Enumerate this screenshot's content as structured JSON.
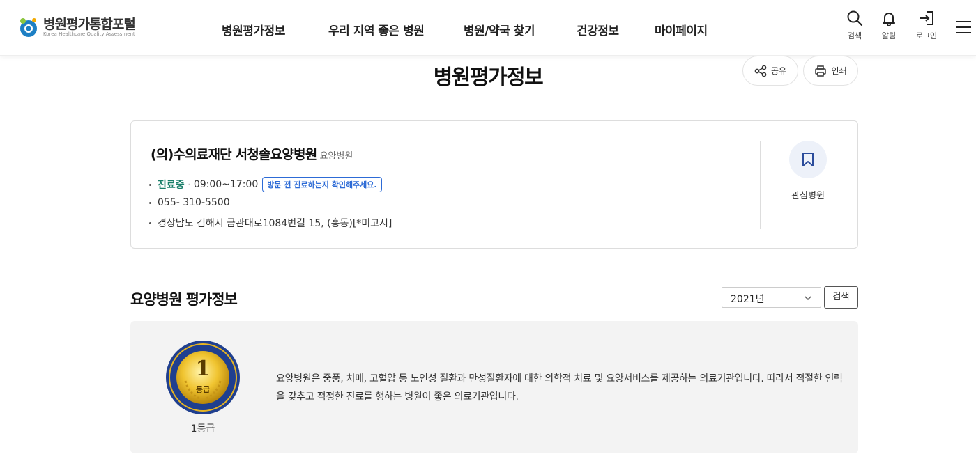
{
  "header": {
    "logo_title": "병원평가통합포털",
    "logo_subtitle": "Korea Healthcare Quality Assessment",
    "nav": [
      "병원평가정보",
      "우리 지역 좋은 병원",
      "병원/약국 찾기",
      "건강정보",
      "마이페이지"
    ],
    "utils": {
      "search_label": "검색",
      "alarm_label": "알림",
      "login_label": "로그인"
    }
  },
  "page": {
    "title": "병원평가정보",
    "share_label": "공유",
    "print_label": "인쇄"
  },
  "hospital": {
    "name": "(의)수의료재단 서청솔요양병원",
    "type": "요양병원",
    "status": "진료중",
    "hours": "09:00~17:00",
    "notice": "방문 전 진료하는지 확인해주세요.",
    "phone": "055- 310-5500",
    "address": "경상남도 김해시 금관대로1084번길 15, (흥동)[*미고시]",
    "favorite_label": "관심병원"
  },
  "evaluation": {
    "section_title": "요양병원 평가정보",
    "year_selected": "2021년",
    "search_label": "검색",
    "grade_number": "1",
    "grade_badge_text": "등급",
    "grade_label": "1등급",
    "description": "요양병원은 중풍, 치매, 고혈압 등 노인성 질환과 만성질환자에 대한 의학적 치료 및 요양서비스를 제공하는 의료기관입니다. 따라서 적절한 인력을 갖추고 적정한 진료를 행하는 병원이 좋은 의료기관입니다."
  },
  "colors": {
    "status_green": "#1b7f6a",
    "notice_blue": "#2d6bd6",
    "medal_gold": "#e6b422",
    "medal_blue": "#1f3f8f"
  }
}
